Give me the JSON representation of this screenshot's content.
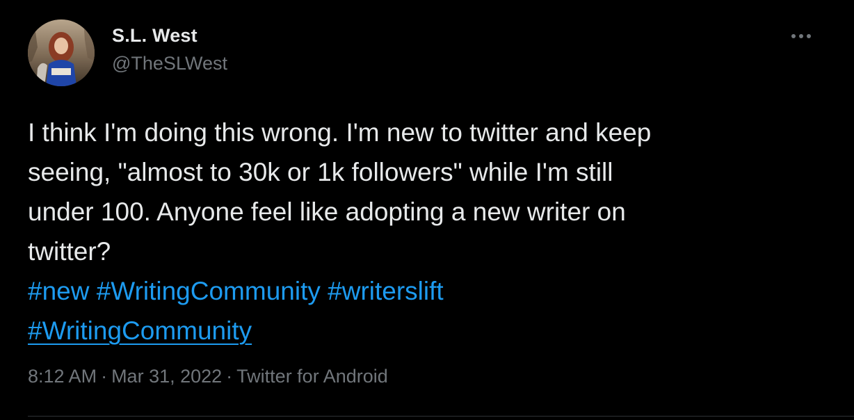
{
  "author": {
    "display_name": "S.L. West",
    "handle": "@TheSLWest",
    "avatar_icon": "profile-photo"
  },
  "more_icon": "more-horizontal-icon",
  "tweet": {
    "lines": [
      "I think I'm doing this wrong. I'm new to twitter and keep",
      "seeing, \"almost to 30k or 1k followers\" while I'm still",
      "under 100.  Anyone feel like adopting a new writer on",
      "twitter?"
    ],
    "hashtags_line1": [
      "#new",
      "#WritingCommunity",
      "#writerslift"
    ],
    "hashtags_line2": [
      "#WritingCommunity"
    ]
  },
  "meta": {
    "time": "8:12 AM",
    "separator": "·",
    "date": "Mar 31, 2022",
    "source": "Twitter for Android"
  },
  "colors": {
    "background": "#000000",
    "text": "#e7e9ea",
    "secondary": "#71767b",
    "link": "#1d9bf0"
  }
}
